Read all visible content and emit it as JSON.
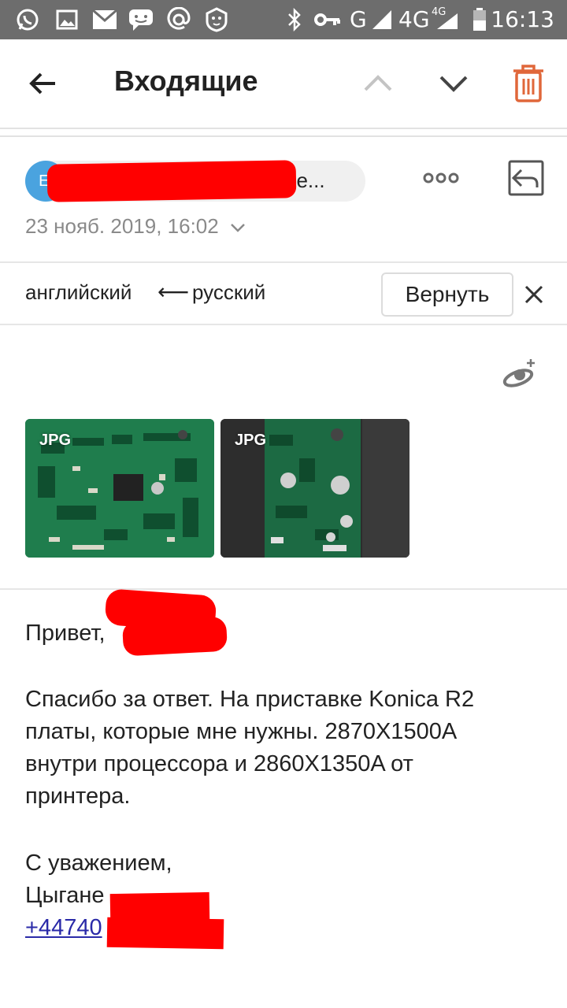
{
  "status_bar": {
    "network_type": "G",
    "network_lte": "4G",
    "network_lte_small": "4G",
    "time": "16:13",
    "icons": [
      "whatsapp-icon",
      "gallery-icon",
      "mail-icon",
      "messenger-icon",
      "at-icon",
      "lion-app-icon",
      "bluetooth-icon",
      "key-icon",
      "signal-icon",
      "signal-icon",
      "battery-icon"
    ]
  },
  "app_bar": {
    "title": "Входящие",
    "back_icon": "arrow-left-icon",
    "prev_icon": "chevron-up-icon",
    "next_icon": "chevron-down-icon",
    "delete_icon": "trash-icon",
    "accent_color": "#e0673a"
  },
  "message_header": {
    "avatar_initials": "El",
    "sender_visible": "ne...",
    "date": "23 нояб. 2019, 16:02"
  },
  "translation": {
    "from_lang": "английский",
    "arrow": "⟵",
    "to_lang": "русский",
    "revert_label": "Вернуть"
  },
  "attachments": [
    {
      "type_badge": "JPG"
    },
    {
      "type_badge": "JPG"
    }
  ],
  "body": {
    "greeting": "Привет,",
    "paragraph_lines": [
      "Спасибо за ответ. На приставке Konica R2",
      "платы, которые мне нужны. 2870X1500A",
      "внутри процессора и 2860X1350A от",
      "принтера."
    ],
    "signoff": "С уважением,",
    "name_partial": "Цыгане",
    "phone_partial": "+44740"
  }
}
